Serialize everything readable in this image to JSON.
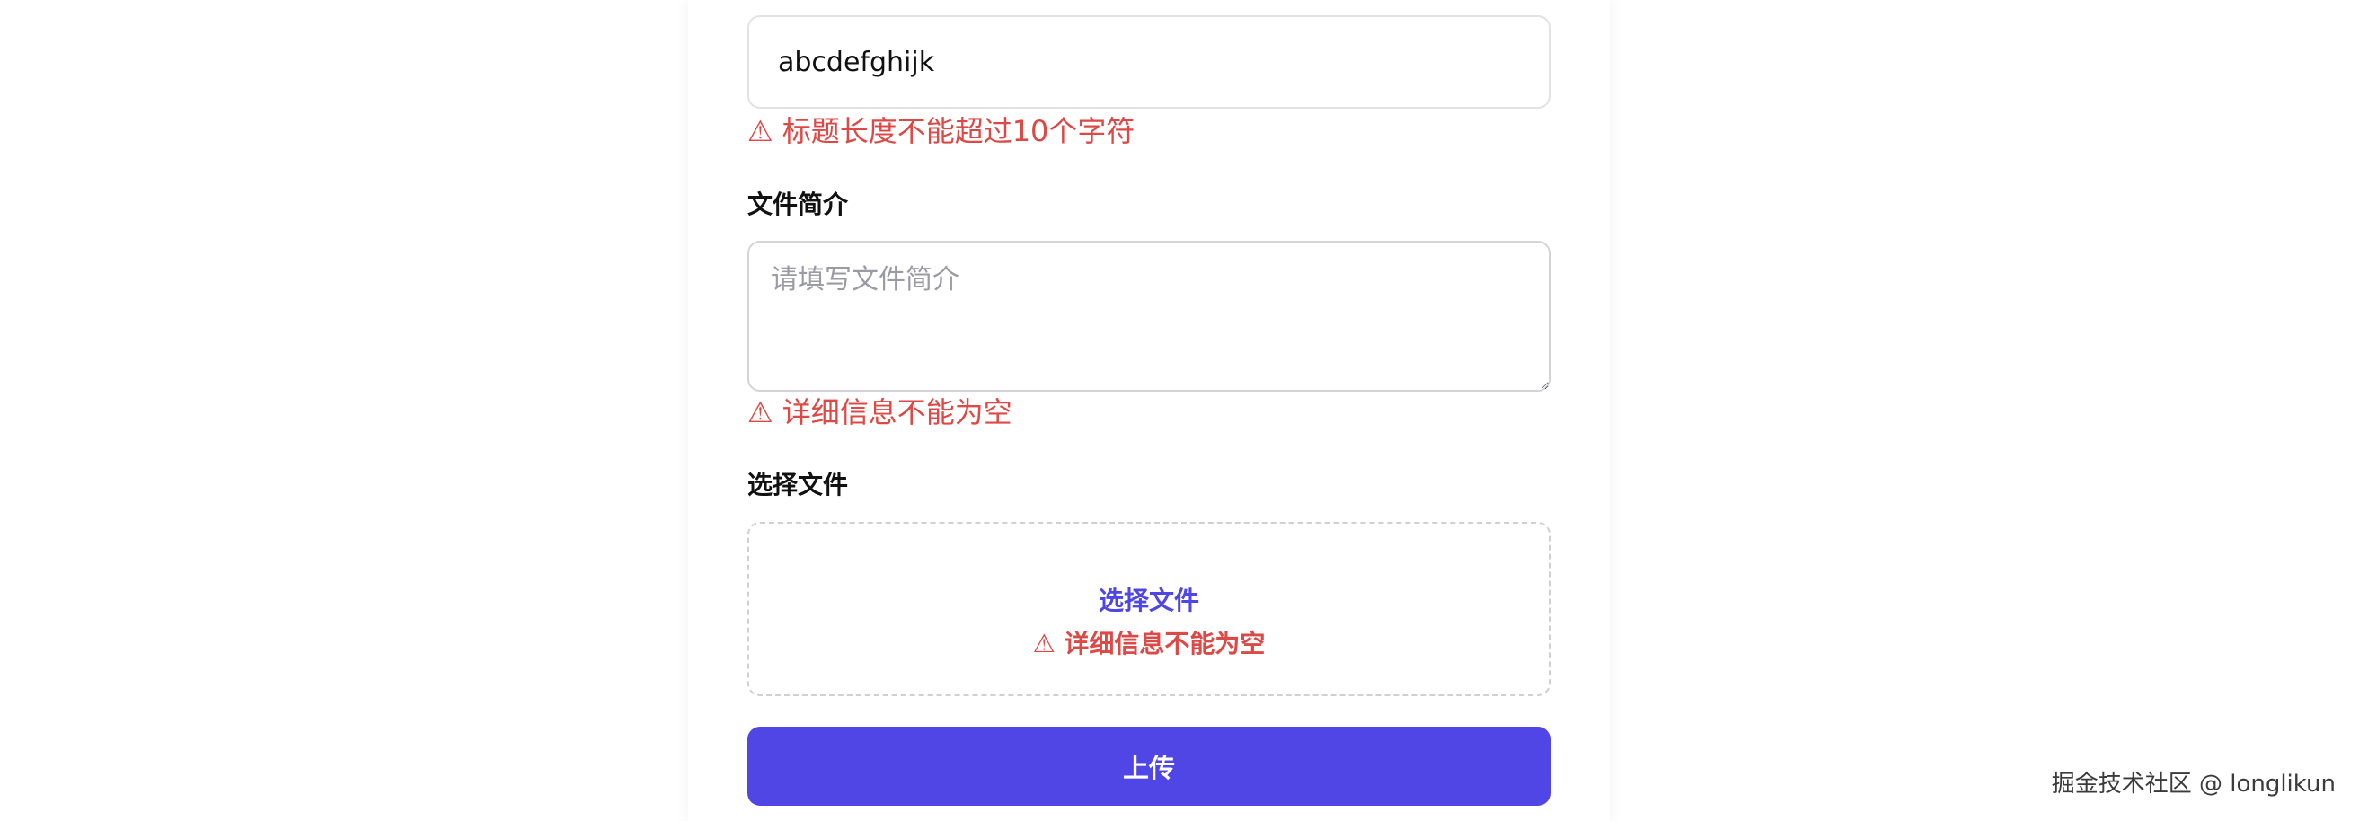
{
  "title_field": {
    "value": "abcdefghijk",
    "error_icon": "⚠",
    "error": "标题长度不能超过10个字符"
  },
  "description_field": {
    "label": "文件简介",
    "placeholder": "请填写文件简介",
    "value": "",
    "error_icon": "⚠",
    "error": "详细信息不能为空"
  },
  "file_field": {
    "label": "选择文件",
    "dropzone_link": "选择文件",
    "error_icon": "⚠",
    "error": "详细信息不能为空"
  },
  "actions": {
    "upload_label": "上传"
  },
  "watermark": "掘金技术社区 @ longlikun",
  "colors": {
    "accent": "#4f46e5",
    "error": "#dc4a47"
  }
}
